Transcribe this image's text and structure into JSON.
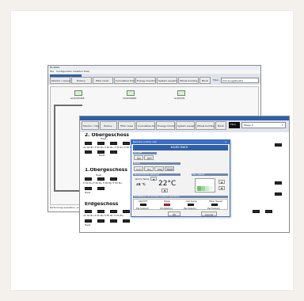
{
  "app": {
    "window_title": "EL-0000",
    "menu": [
      "File",
      "Configuration",
      "View",
      "Tool",
      "Help"
    ]
  },
  "back_toolbar": {
    "buttons": [
      "Monitor / operation",
      "History",
      "Filter reset",
      "Cumulative time",
      "Energy monitoring",
      "System equipment",
      "Whole building",
      "Block"
    ],
    "floor_label": "Floor",
    "floor_value": "Schulungsfluszhe"
  },
  "back_devices": [
    "ALD200366",
    "C03200966",
    "ALD2031"
  ],
  "back_status": "Performing operation, prohibit cont",
  "front_toolbar": {
    "buttons": [
      "Monitor / Operation",
      "History",
      "Filter reset",
      "Cumulative time",
      "Energy monitoring",
      "System equipment",
      "Whole building",
      "Block"
    ],
    "floor_label": "Floor",
    "floor_value": "Etage 3"
  },
  "floors": [
    {
      "name": "2. Obergeschoss",
      "labels": [
        "Heat",
        "Heat",
        "Heat",
        "Heat"
      ],
      "temps": "21'30 Bu  3'30 Bu  3'30 Bu  3'30 Bu  3'30 Bu  3'30 Bu  3'30 Bu  3'30 Bu"
    },
    {
      "name": "1.Obergeschoss",
      "labels": [
        "Heat",
        "Heat",
        "Heat"
      ],
      "temps": "5'30 Bu  5'30 Bu  5'30 Bu  5'30 Bu"
    },
    {
      "name": "Erdgeschoss",
      "labels": [
        "Heat",
        "Heat",
        "Heat",
        "Heat"
      ],
      "temps": "21'30 Bu  5'30 Bu  5'30 Bu  5'30 Bu"
    }
  ],
  "dialog": {
    "title": "Remote control unit",
    "header": "EG05 Büro",
    "onoff_label": "On/Off",
    "onoff_buttons": [
      "ON",
      "OFF"
    ],
    "mode_label": "Mode",
    "mode_buttons": [
      "Cool",
      "Dry",
      "FAN",
      "Heat"
    ],
    "temp_section_label": "Temperature settings",
    "room_temp_label": "Room Temp",
    "room_temp": "24 °C",
    "setpoint": "22°C",
    "fan_section_label": "Fan speed",
    "perm_section_label": "Prohibition of remote control operation",
    "perm_columns": [
      "ON/OFF",
      "Mode",
      "Set temp",
      "Filter Reset"
    ],
    "perm_values": [
      "Permission",
      "Prohibition",
      "Permission",
      "Permission"
    ],
    "ok": "OK",
    "cancel": "Cancel"
  },
  "colors": {
    "card_bg": "#ffffff",
    "page_bg": "#f4f1ec",
    "toolbar_blue": "#2f5fa8",
    "title_blue": "#3a6fc4"
  }
}
